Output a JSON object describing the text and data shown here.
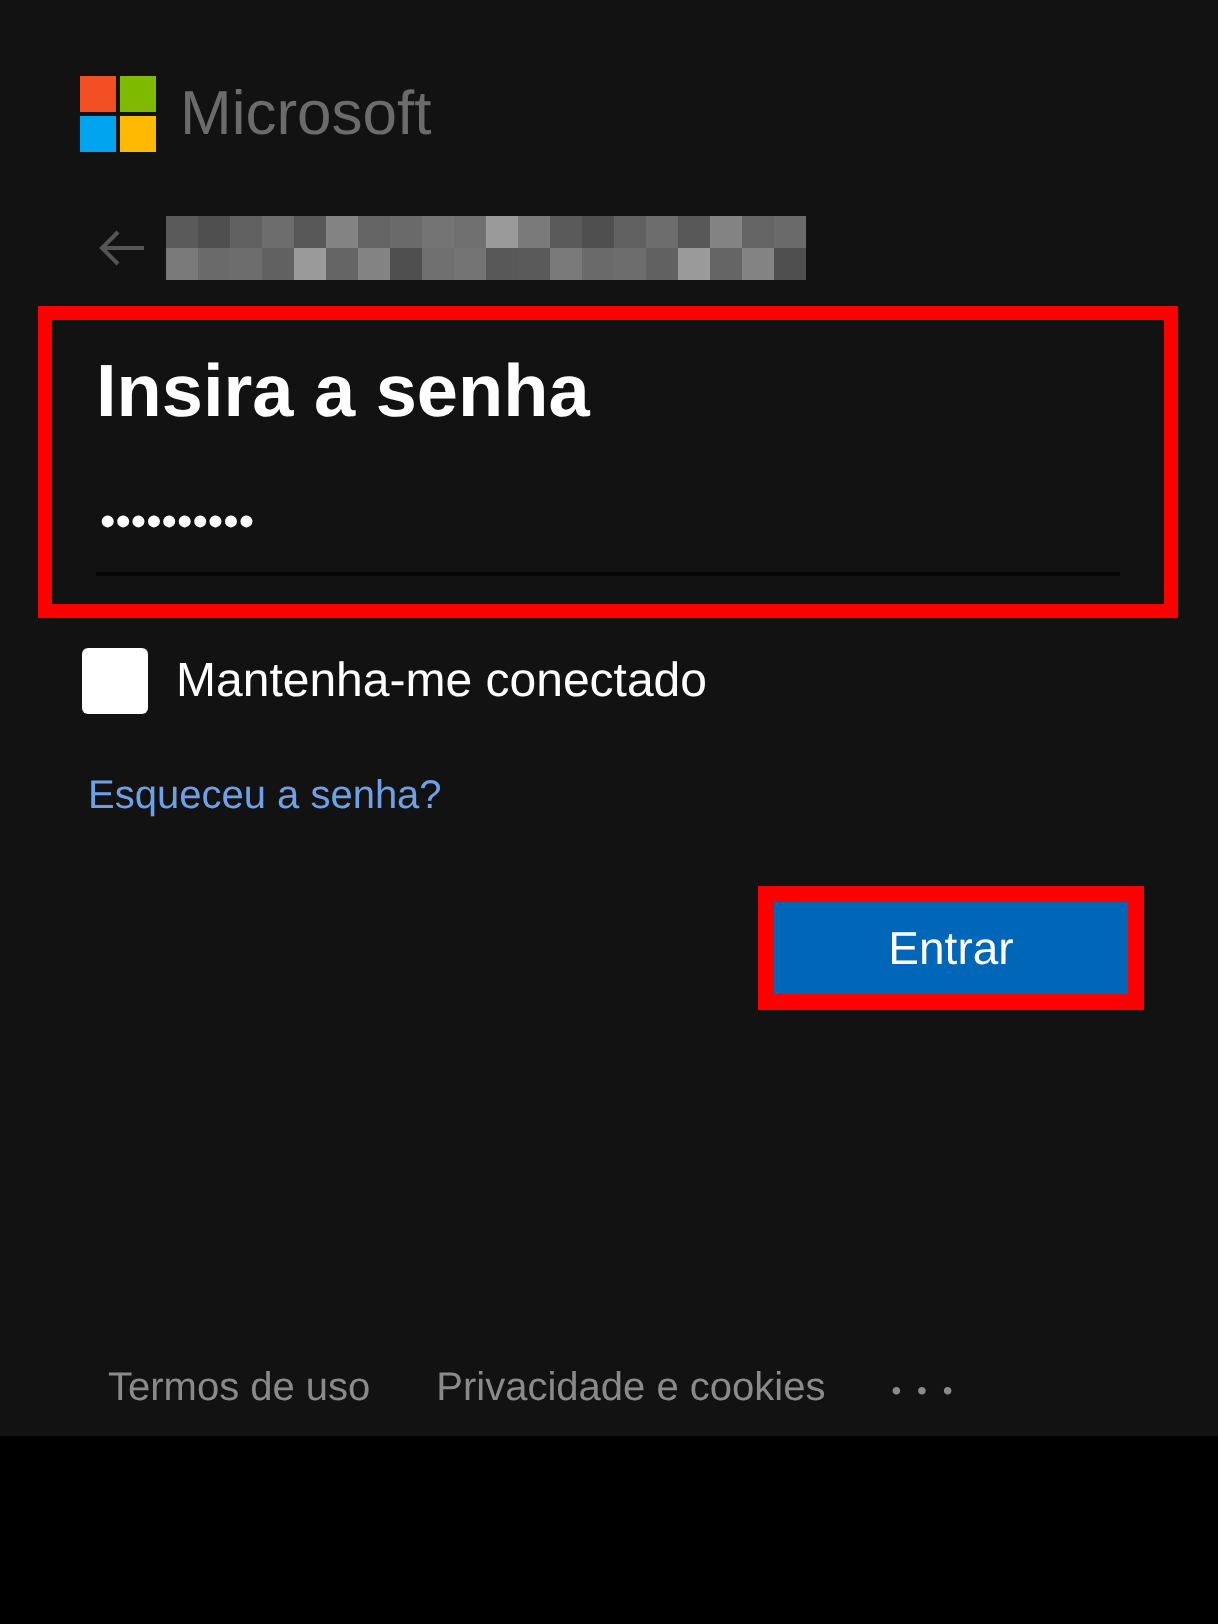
{
  "brand": {
    "name": "Microsoft"
  },
  "heading": {
    "text": "Insira a senha",
    "highlighted": true
  },
  "password": {
    "value": "••••••••••"
  },
  "remember": {
    "label": "Mantenha-me conectado",
    "checked": false
  },
  "forgot_link": "Esqueceu a senha?",
  "submit": {
    "label": "Entrar",
    "highlighted": true
  },
  "footer": {
    "links": [
      "Termos de uso",
      "Privacidade e cookies"
    ],
    "more": "• • •"
  }
}
